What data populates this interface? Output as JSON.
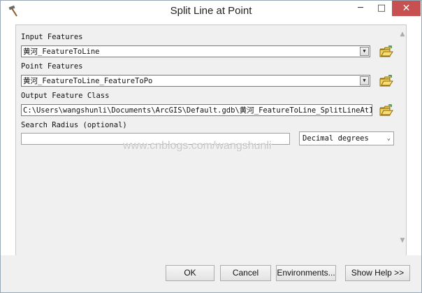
{
  "window": {
    "title": "Split Line at Point"
  },
  "titlebar": {
    "minimize": "─",
    "maximize": "□",
    "close": "✕"
  },
  "form": {
    "input_features": {
      "label": "Input Features",
      "value": "黄河_FeatureToLine"
    },
    "point_features": {
      "label": "Point Features",
      "value": "黄河_FeatureToLine_FeatureToPo"
    },
    "output_feature_class": {
      "label": "Output Feature Class",
      "value": "C:\\Users\\wangshunli\\Documents\\ArcGIS\\Default.gdb\\黄河_FeatureToLine_SplitLineAt1"
    },
    "search_radius": {
      "label": "Search Radius (optional)",
      "value": "",
      "units": "Decimal degrees"
    }
  },
  "watermark": "www.cnblogs.com/wangshunli",
  "buttons": {
    "ok": "OK",
    "cancel": "Cancel",
    "environments": "Environments...",
    "show_help": "Show Help >>"
  },
  "icons": {
    "app": "hammer-icon",
    "browse": "open-folder-icon",
    "dropdown": "chevron-down-icon"
  }
}
